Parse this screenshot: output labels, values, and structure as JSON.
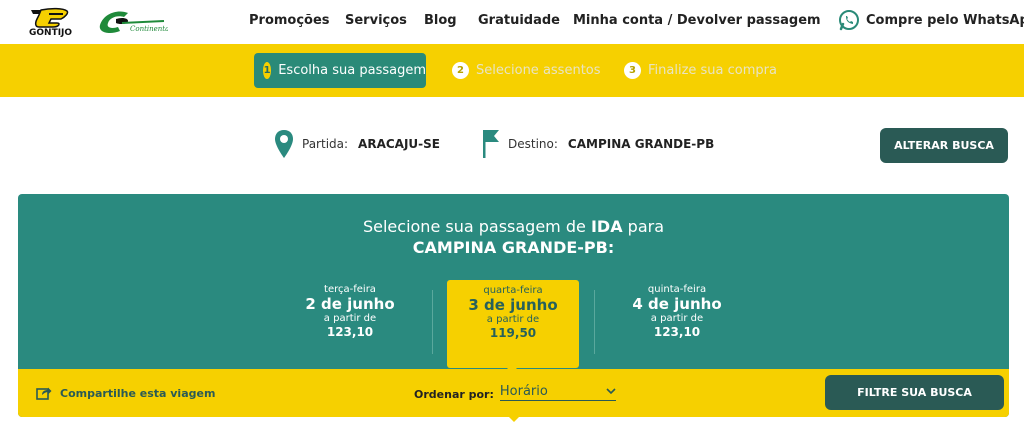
{
  "brand": {
    "logo_gontijo_text": "GONTIJO",
    "logo_continental_text": "Continental"
  },
  "nav": {
    "items": [
      {
        "label": "Promoções"
      },
      {
        "label": "Serviços"
      },
      {
        "label": "Blog"
      },
      {
        "label": "Gratuidade"
      },
      {
        "label": "Minha conta / Devolver passagem"
      }
    ],
    "whatsapp_label": "Compre pelo WhatsApp"
  },
  "steps": [
    {
      "num": "1",
      "label": "Escolha sua passagem",
      "active": true
    },
    {
      "num": "2",
      "label": "Selecione assentos",
      "active": false
    },
    {
      "num": "3",
      "label": "Finalize sua compra",
      "active": false
    }
  ],
  "route": {
    "origin_label": "Partida:",
    "origin_value": "ARACAJU-SE",
    "destination_label": "Destino:",
    "destination_value": "CAMPINA GRANDE-PB",
    "alter_button": "ALTERAR BUSCA"
  },
  "selection": {
    "title_prefix": "Selecione sua passagem de",
    "title_direction": "IDA",
    "title_suffix": "para",
    "destination": "CAMPINA GRANDE-PB:",
    "days": [
      {
        "weekday": "terça-feira",
        "date": "2 de junho",
        "from_label": "a partir de",
        "price": "123,10",
        "selected": false
      },
      {
        "weekday": "quarta-feira",
        "date": "3 de junho",
        "from_label": "a partir de",
        "price": "119,50",
        "selected": true
      },
      {
        "weekday": "quinta-feira",
        "date": "4 de junho",
        "from_label": "a partir de",
        "price": "123,10",
        "selected": false
      }
    ]
  },
  "toolbar": {
    "share_label": "Compartilhe esta viagem",
    "order_label": "Ordenar por:",
    "order_value": "Horário",
    "filter_button": "FILTRE SUA BUSCA"
  },
  "colors": {
    "yellow": "#f6d000",
    "teal": "#2a8a7f",
    "dark_teal": "#2a5a55",
    "whatsapp_green": "#2a8a78"
  },
  "icons": [
    "gontijo-logo",
    "continental-logo",
    "whatsapp-icon",
    "location-pin-icon",
    "flag-icon",
    "share-icon",
    "chevron-down-icon"
  ]
}
